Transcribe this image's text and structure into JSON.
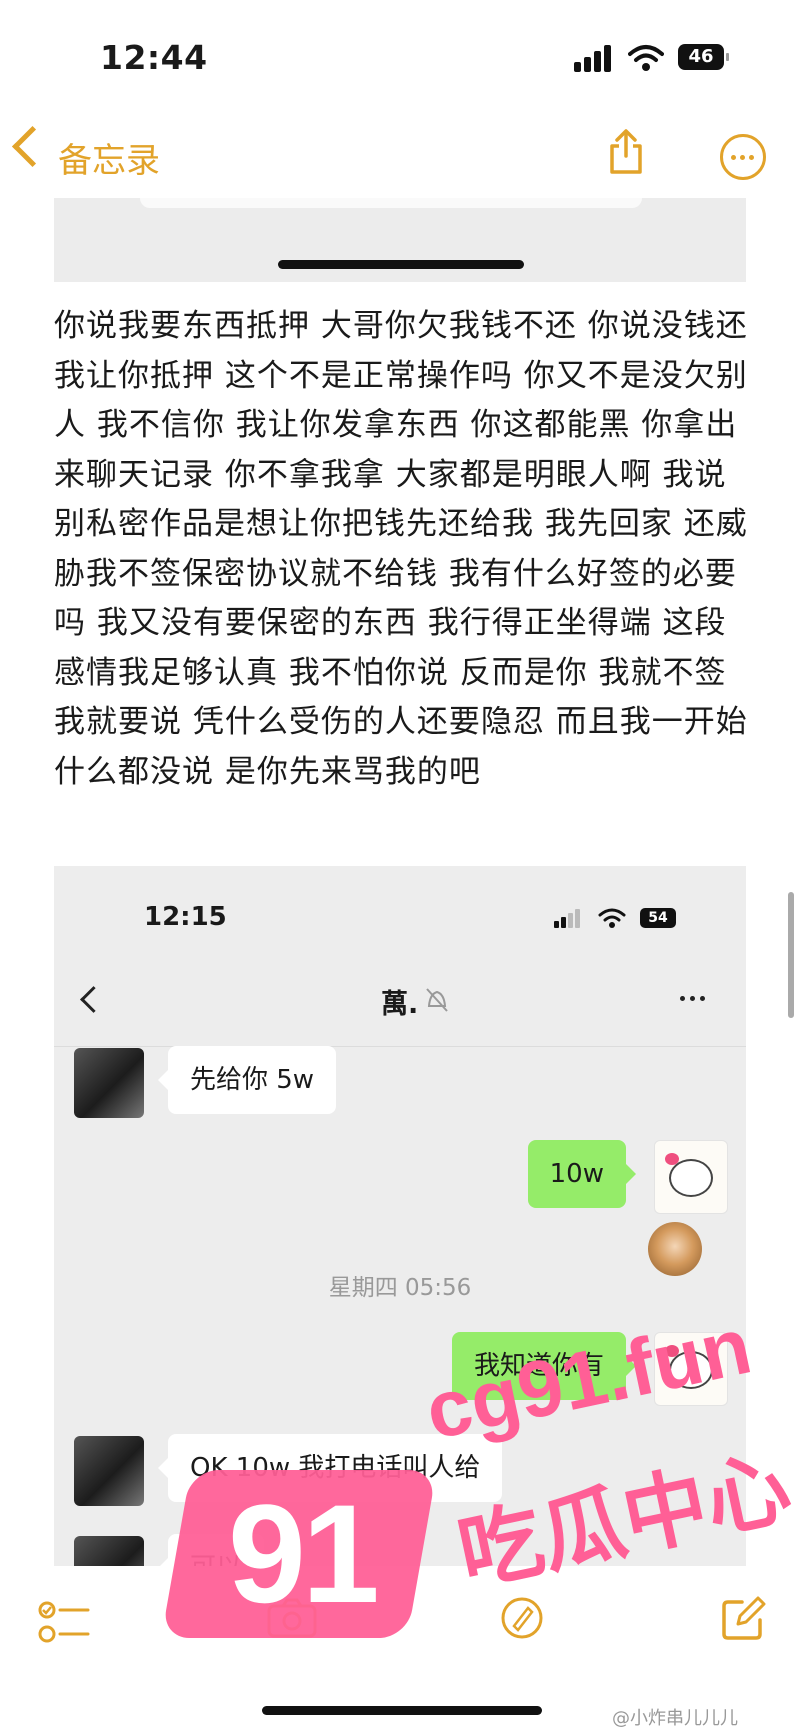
{
  "status_bar": {
    "time": "12:44",
    "battery": "46"
  },
  "nav": {
    "back_label": "备忘录"
  },
  "note": {
    "text": "你说我要东西抵押 大哥你欠我钱不还 你说没钱还 我让你抵押 这个不是正常操作吗 你又不是没欠别人 我不信你 我让你发拿东西 你这都能黑 你拿出来聊天记录 你不拿我拿 大家都是明眼人啊 我说别私密作品是想让你把钱先还给我 我先回家 还威胁我不签保密协议就不给钱 我有什么好签的必要吗 我又没有要保密的东西 我行得正坐得端 这段感情我足够认真 我不怕你说 反而是你 我就不签 我就要说 凭什么受伤的人还要隐忍 而且我一开始什么都没说 是你先来骂我的吧"
  },
  "chat_screenshot": {
    "status_time": "12:15",
    "battery": "54",
    "contact_name": "萬.",
    "messages": [
      {
        "side": "left",
        "text": "先给你 5w"
      },
      {
        "side": "right",
        "text": "10w"
      },
      {
        "side": "center",
        "text": "星期四 05:56"
      },
      {
        "side": "right",
        "text": "我知道你有"
      },
      {
        "side": "left",
        "text": "OK 10w 我打电话叫人给"
      },
      {
        "side": "left",
        "text": "可以"
      }
    ]
  },
  "watermark": {
    "number": "91",
    "site": "cg91.fun",
    "label": "吃瓜中心"
  },
  "footer": {
    "weibo_handle": "@小炸串儿儿儿"
  },
  "colors": {
    "accent": "#e2a32a",
    "bubble_green": "#95ec69",
    "watermark_pink": "#ff5f96"
  }
}
